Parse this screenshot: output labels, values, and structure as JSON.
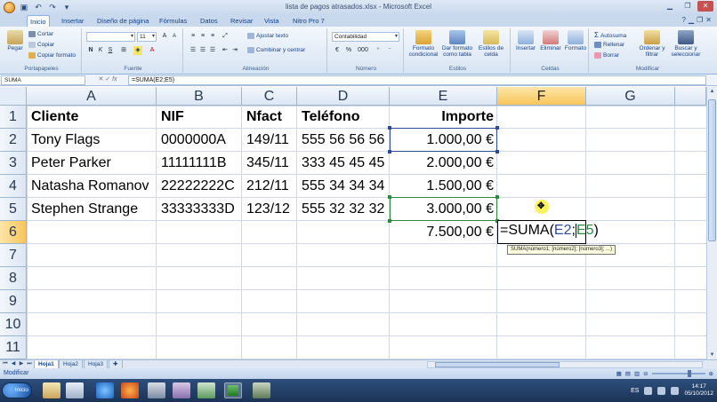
{
  "window": {
    "title": "lista de pagos atrasados.xlsx - Microsoft Excel",
    "quick_access": [
      "save-icon",
      "undo-icon",
      "redo-icon"
    ],
    "buttons": [
      "minimize",
      "maximize",
      "close"
    ]
  },
  "ribbon_tabs": [
    {
      "label": "Inicio",
      "active": true
    },
    {
      "label": "Insertar"
    },
    {
      "label": "Diseño de página"
    },
    {
      "label": "Fórmulas"
    },
    {
      "label": "Datos"
    },
    {
      "label": "Revisar"
    },
    {
      "label": "Vista"
    },
    {
      "label": "Nitro Pro 7"
    }
  ],
  "ribbon": {
    "clipboard": {
      "label": "Portapapeles",
      "paste": "Pegar",
      "cut": "Cortar",
      "copy": "Copiar",
      "format_painter": "Copiar formato"
    },
    "font": {
      "label": "Fuente",
      "font_name": "",
      "font_size": "11",
      "bold": "N",
      "italic": "K",
      "underline": "S"
    },
    "alignment": {
      "label": "Alineación",
      "wrap": "Ajustar texto",
      "merge": "Combinar y centrar"
    },
    "number": {
      "label": "Número",
      "format": "Contabilidad",
      "currency": "€",
      "percent": "%",
      "thousands": "000"
    },
    "styles": {
      "label": "Estilos",
      "conditional": "Formato condicional",
      "as_table": "Dar formato como tabla",
      "cell_styles": "Estilos de celda"
    },
    "cells": {
      "label": "Celdas",
      "insert": "Insertar",
      "delete": "Eliminar",
      "format": "Formato"
    },
    "editing": {
      "label": "Modificar",
      "autosum": "Autosuma",
      "fill": "Rellenar",
      "clear": "Borrar",
      "sort_filter": "Ordenar y filtrar",
      "find_select": "Buscar y seleccionar"
    }
  },
  "formula_bar": {
    "name_box": "SUMA",
    "cancel": "✕",
    "enter": "✓",
    "fx": "fx",
    "formula": "=SUMA(E2;E5)"
  },
  "columns": [
    "A",
    "B",
    "C",
    "D",
    "E",
    "F",
    "G"
  ],
  "rows": [
    "1",
    "2",
    "3",
    "4",
    "5",
    "6",
    "7",
    "8",
    "9",
    "10",
    "11"
  ],
  "table": {
    "headers": [
      "Cliente",
      "NIF",
      "Nfact",
      "Teléfono",
      "Importe"
    ],
    "data": [
      [
        "Tony Flags",
        "0000000A",
        "149/11",
        "555 56 56 56",
        "1.000,00 €"
      ],
      [
        "Peter Parker",
        "11111111B",
        "345/11",
        "333 45 45 45",
        "2.000,00 €"
      ],
      [
        "Natasha Romanov",
        "22222222C",
        "212/11",
        "555 34 34 34",
        "1.500,00 €"
      ],
      [
        "Stephen Strange",
        "33333333D",
        "123/12",
        "555 32 32 32",
        "3.000,00 €"
      ]
    ],
    "total": "7.500,00 €"
  },
  "edit_cell": {
    "prefix": "=SUMA(",
    "ref1": "E2",
    "sep": ";",
    "ref2": "E5",
    "suffix": ")",
    "tooltip": "SUMA(número1; [número2]; [número3]; ...)"
  },
  "sheets": [
    {
      "label": "Hoja1",
      "active": true
    },
    {
      "label": "Hoja2"
    },
    {
      "label": "Hoja3"
    }
  ],
  "status": {
    "mode": "Modificar"
  },
  "taskbar": {
    "start": "Inicio",
    "lang": "ES",
    "time": "14:17",
    "date": "05/10/2012"
  },
  "colors": {
    "ref1": "#2e4a9e",
    "ref2": "#2b8a3e",
    "selected_header": "#f8c65a"
  }
}
